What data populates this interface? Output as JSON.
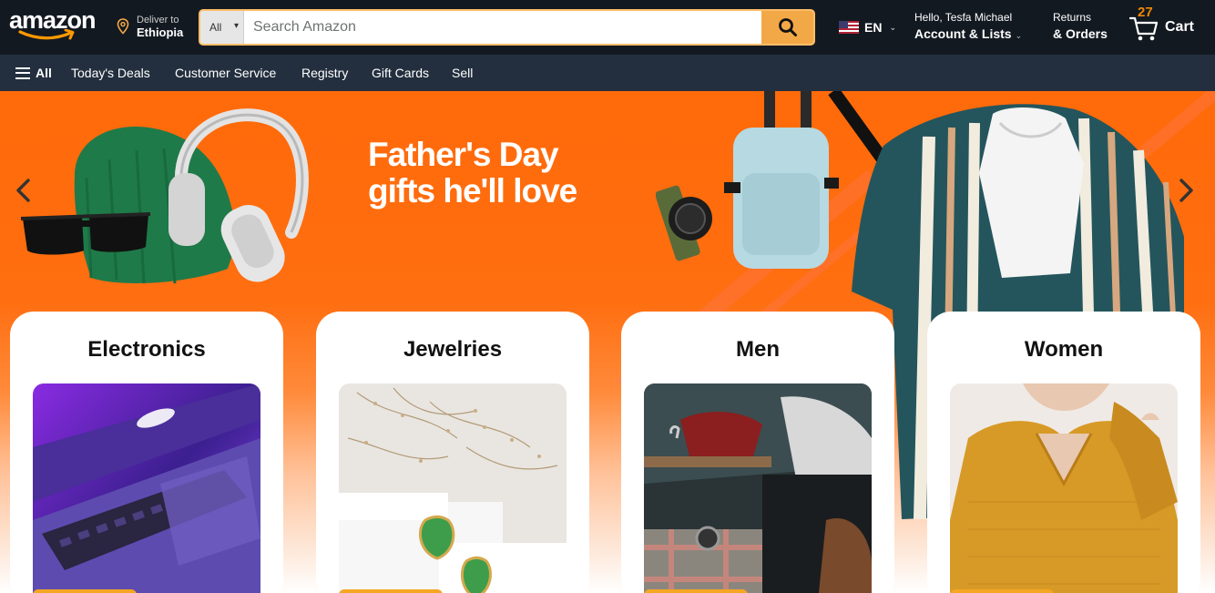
{
  "header": {
    "logo": "amazon",
    "deliver_line1": "Deliver to",
    "deliver_line2": "Ethiopia",
    "search_category": "All",
    "search_placeholder": "Search Amazon",
    "language": "EN",
    "account_line1": "Hello, Tesfa Michael",
    "account_line2": "Account & Lists",
    "orders_line1": "Returns",
    "orders_line2": "& Orders",
    "cart_count": "27",
    "cart_label": "Cart"
  },
  "subnav": {
    "all_label": "All",
    "items": [
      "Today's Deals",
      "Customer Service",
      "Registry",
      "Gift Cards",
      "Sell"
    ]
  },
  "hero": {
    "headline_line1": "Father's Day",
    "headline_line2": "gifts he'll love"
  },
  "categories": [
    {
      "title": "Electronics"
    },
    {
      "title": "Jewelries"
    },
    {
      "title": "Men"
    },
    {
      "title": "Women"
    }
  ],
  "colors": {
    "topbar": "#131921",
    "subnav": "#232f3e",
    "accent": "#febd69",
    "hero_orange": "#ff6a0a",
    "cart_count": "#f08804"
  }
}
